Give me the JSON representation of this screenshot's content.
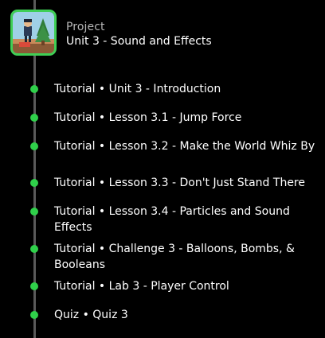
{
  "project": {
    "kicker": "Project",
    "title": "Unit 3 - Sound and Effects",
    "thumbnail_icon": "game-scene-thumbnail"
  },
  "colors": {
    "background": "#000000",
    "timeline": "#5a5a5a",
    "accent_green": "#2fd04a",
    "muted_text": "#b7b7b7"
  },
  "items": [
    {
      "label": "Tutorial • Unit 3 - Introduction"
    },
    {
      "label": "Tutorial • Lesson 3.1 - Jump Force"
    },
    {
      "label": "Tutorial • Lesson 3.2 - Make the World Whiz By"
    },
    {
      "label": "Tutorial • Lesson 3.3 - Don't Just Stand There"
    },
    {
      "label": "Tutorial • Lesson 3.4 - Particles and Sound Effects"
    },
    {
      "label": "Tutorial • Challenge 3 - Balloons, Bombs, & Booleans"
    },
    {
      "label": "Tutorial • Lab 3 - Player Control"
    },
    {
      "label": "Quiz • Quiz 3"
    }
  ]
}
